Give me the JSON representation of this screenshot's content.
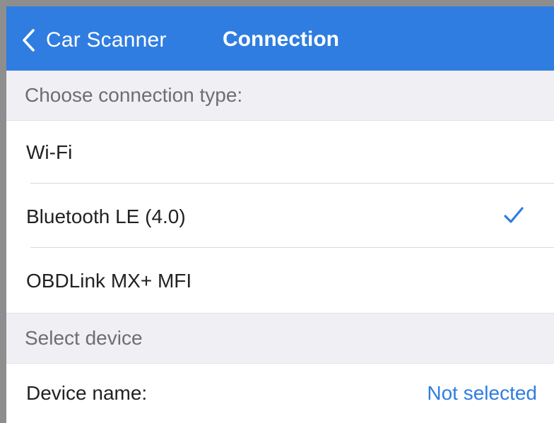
{
  "navbar": {
    "back_label": "Car Scanner",
    "title": "Connection",
    "background_color": "#2f7de1"
  },
  "connection_section": {
    "header": "Choose connection type:",
    "options": [
      {
        "label": "Wi-Fi",
        "selected": false
      },
      {
        "label": "Bluetooth LE (4.0)",
        "selected": true
      },
      {
        "label": "OBDLink MX+ MFI",
        "selected": false
      }
    ],
    "checkmark_icon": "checkmark-icon"
  },
  "device_section": {
    "header": "Select device",
    "device_name_label": "Device name:",
    "device_name_value": "Not selected"
  },
  "colors": {
    "accent": "#2f7de1",
    "section_bg": "#efeff4",
    "section_text": "#6d6d72"
  }
}
